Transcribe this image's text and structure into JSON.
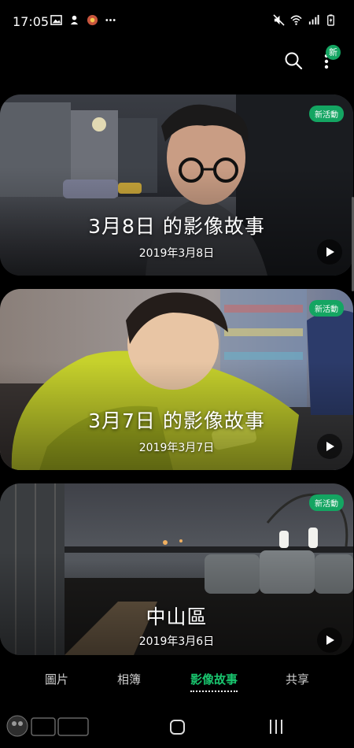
{
  "status_bar": {
    "time": "17:05",
    "left_icons": [
      "gallery-icon",
      "notification-icon",
      "app-icon",
      "more-dots-icon"
    ],
    "right_icons": [
      "mute-icon",
      "wifi-icon",
      "signal-icon",
      "battery-charging-icon"
    ]
  },
  "top_bar": {
    "search_icon": "search-icon",
    "more_icon": "more-vertical-icon",
    "new_badge": "新"
  },
  "stories": [
    {
      "title": "3月8日 的影像故事",
      "date": "2019年3月8日",
      "badge": "新活動",
      "play_icon": "play-icon"
    },
    {
      "title": "3月7日 的影像故事",
      "date": "2019年3月7日",
      "badge": "新活動",
      "play_icon": "play-icon"
    },
    {
      "title": "中山區",
      "date": "2019年3月6日",
      "badge": "新活動",
      "play_icon": "play-icon"
    }
  ],
  "tabs": [
    {
      "label": "圖片",
      "active": false
    },
    {
      "label": "相簿",
      "active": false
    },
    {
      "label": "影像故事",
      "active": true
    },
    {
      "label": "共享",
      "active": false
    }
  ],
  "nav_bar": {
    "home_icon": "home-icon",
    "recents_icon": "recents-icon"
  },
  "colors": {
    "accent": "#14a562",
    "active_tab": "#19c46e",
    "background": "#000000"
  }
}
